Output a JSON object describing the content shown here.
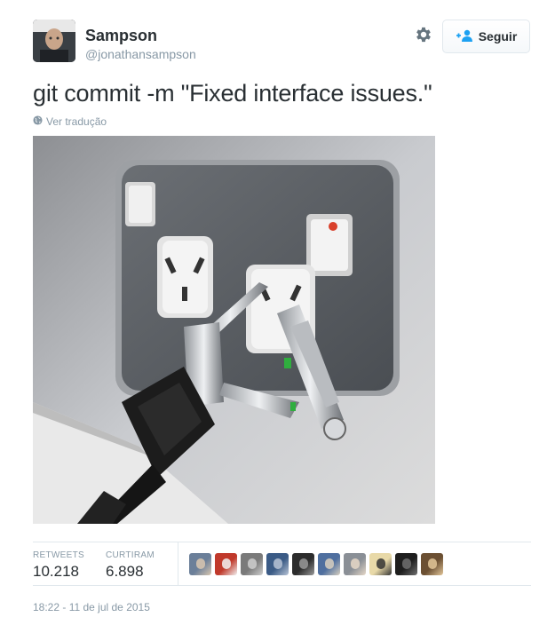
{
  "author": {
    "name": "Sampson",
    "handle": "@jonathansampson"
  },
  "actions": {
    "settings_icon": "gear-icon",
    "follow_label": "Seguir",
    "follow_icon": "add-user-icon"
  },
  "tweet": {
    "text": "git commit -m \"Fixed interface issues.\"",
    "translate_label": "Ver tradução",
    "translate_icon": "globe-icon"
  },
  "stats": {
    "retweets_label": "RETWEETS",
    "retweets_value": "10.218",
    "likes_label": "CURTIRAM",
    "likes_value": "6.898"
  },
  "likers": [
    {
      "colors": [
        "#6b7f99",
        "#d9c7b0"
      ]
    },
    {
      "colors": [
        "#c0392b",
        "#f2f2f2"
      ]
    },
    {
      "colors": [
        "#7a7a7a",
        "#cfcfcf"
      ]
    },
    {
      "colors": [
        "#3b5b86",
        "#b8c4d6"
      ]
    },
    {
      "colors": [
        "#2c2c2c",
        "#9a9a9a"
      ]
    },
    {
      "colors": [
        "#4f6f9f",
        "#d8d0c0"
      ]
    },
    {
      "colors": [
        "#8a8f96",
        "#e6d8c8"
      ]
    },
    {
      "colors": [
        "#e8d9a8",
        "#333333"
      ]
    },
    {
      "colors": [
        "#1e1e1e",
        "#707070"
      ]
    },
    {
      "colors": [
        "#6b4f32",
        "#e3c79a"
      ]
    }
  ],
  "timestamp": "18:22 - 11 de jul de 2015",
  "colors": {
    "accent": "#1da1f2",
    "text": "#292f33",
    "muted": "#8899a6",
    "border": "#e1e8ed"
  }
}
